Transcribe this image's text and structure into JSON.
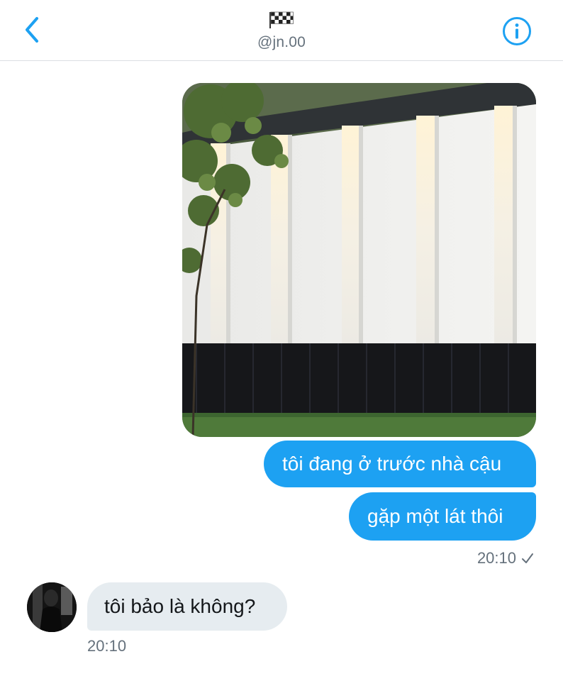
{
  "header": {
    "handle": "@jn.00",
    "flag_icon": "checkered-flag-icon",
    "back_icon": "chevron-left-icon",
    "info_icon": "info-icon"
  },
  "messages": {
    "photo_icon": "photo-attachment",
    "outgoing": [
      {
        "text": "tôi đang ở trước nhà cậu"
      },
      {
        "text": "gặp một lát thôi"
      }
    ],
    "outgoing_time": "20:10",
    "outgoing_status_icon": "checkmark-icon",
    "incoming": {
      "text": "tôi bảo là không?",
      "time": "20:10"
    }
  },
  "colors": {
    "accent": "#1da1f2",
    "incoming_bubble": "#e6ecf0",
    "secondary_text": "#65717c"
  }
}
